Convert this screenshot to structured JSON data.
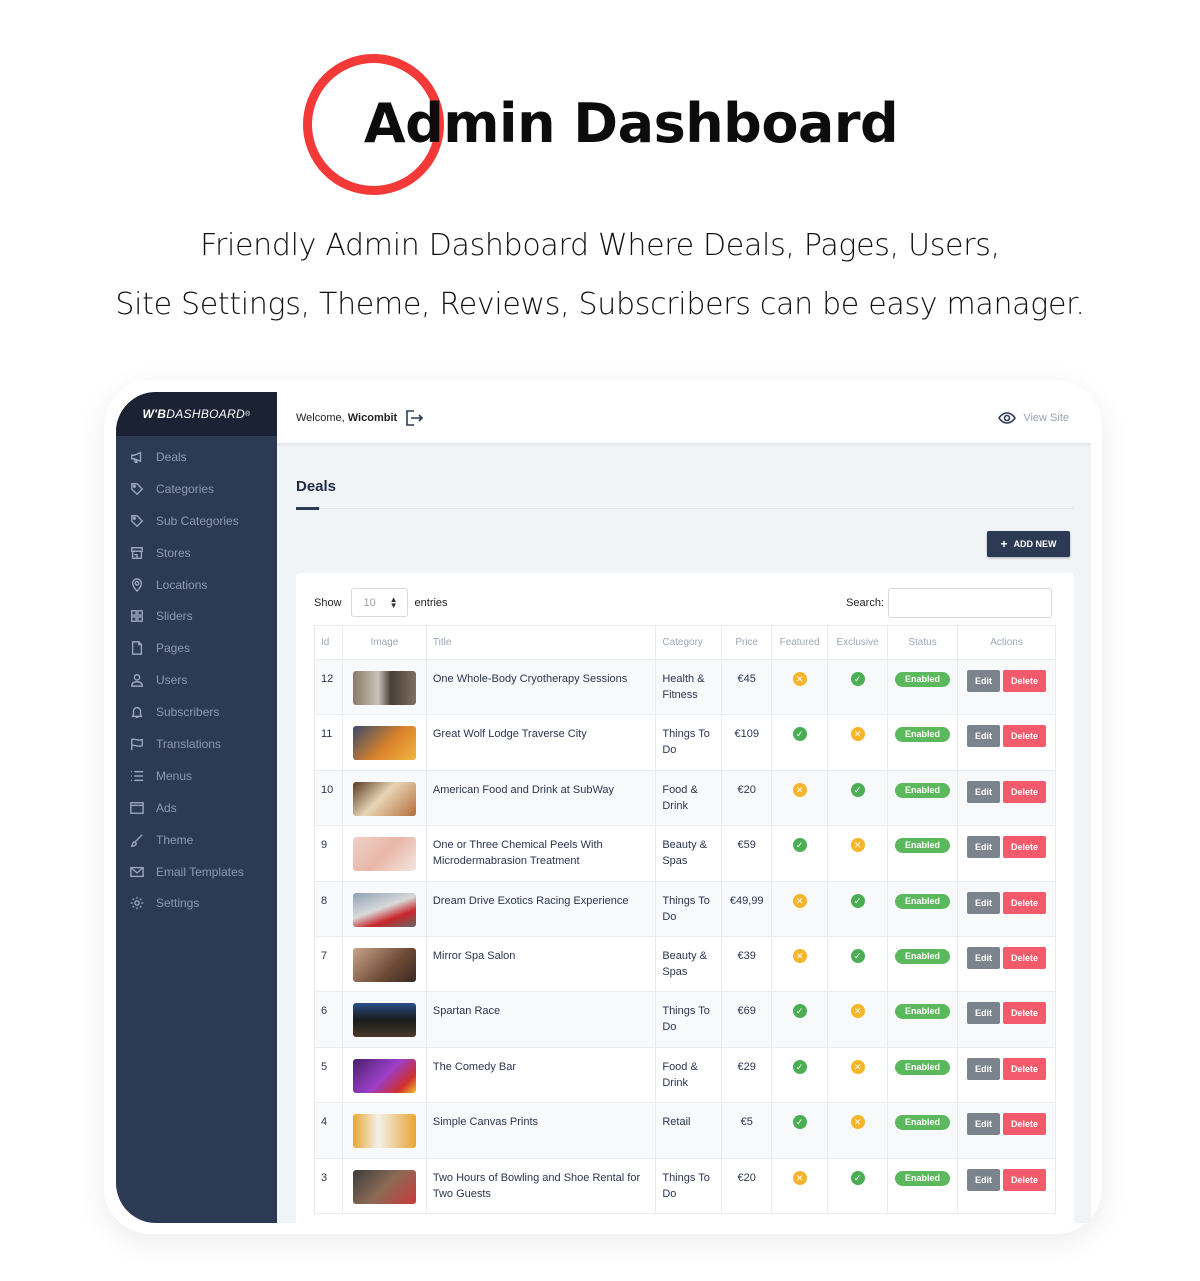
{
  "hero": {
    "title": "Admin Dashboard",
    "subtitle_line1": "Friendly Admin Dashboard Where Deals, Pages, Users,",
    "subtitle_line2": "Site Settings, Theme, Reviews, Subscribers can be easy manager.",
    "accent_color": "#f43939"
  },
  "brand": {
    "part1": "W'B",
    "part2": "DASHBOARD",
    "reg": "®"
  },
  "sidebar": {
    "items": [
      {
        "label": "Deals",
        "icon": "megaphone-icon"
      },
      {
        "label": "Categories",
        "icon": "tag-icon"
      },
      {
        "label": "Sub Categories",
        "icon": "tag-icon"
      },
      {
        "label": "Stores",
        "icon": "store-icon"
      },
      {
        "label": "Locations",
        "icon": "map-pin-icon"
      },
      {
        "label": "Sliders",
        "icon": "grid-icon"
      },
      {
        "label": "Pages",
        "icon": "file-icon"
      },
      {
        "label": "Users",
        "icon": "user-icon"
      },
      {
        "label": "Subscribers",
        "icon": "bell-icon"
      },
      {
        "label": "Translations",
        "icon": "flag-icon"
      },
      {
        "label": "Menus",
        "icon": "list-icon"
      },
      {
        "label": "Ads",
        "icon": "window-icon"
      },
      {
        "label": "Theme",
        "icon": "brush-icon"
      },
      {
        "label": "Email Templates",
        "icon": "mail-icon"
      },
      {
        "label": "Settings",
        "icon": "gear-icon"
      }
    ]
  },
  "topbar": {
    "welcome_prefix": "Welcome, ",
    "username": "Wicombit",
    "view_site": "View Site"
  },
  "page": {
    "title": "Deals",
    "add_new": "ADD NEW",
    "show_label": "Show",
    "entries_value": "10",
    "entries_label": "entries",
    "search_label": "Search:",
    "search_value": ""
  },
  "table": {
    "headers": [
      "Id",
      "Image",
      "Title",
      "Category",
      "Price",
      "Featured",
      "Exclusive",
      "Status",
      "Actions"
    ],
    "rows": [
      {
        "id": "12",
        "title": "One Whole-Body Cryotherapy Sessions",
        "category": "Health & Fitness",
        "price": "€45",
        "featured": false,
        "exclusive": true,
        "status": "Enabled"
      },
      {
        "id": "11",
        "title": "Great Wolf Lodge Traverse City",
        "category": "Things To Do",
        "price": "€109",
        "featured": true,
        "exclusive": false,
        "status": "Enabled"
      },
      {
        "id": "10",
        "title": "American Food and Drink at SubWay",
        "category": "Food & Drink",
        "price": "€20",
        "featured": false,
        "exclusive": true,
        "status": "Enabled"
      },
      {
        "id": "9",
        "title": "One or Three Chemical Peels With Microdermabrasion Treatment",
        "category": "Beauty & Spas",
        "price": "€59",
        "featured": true,
        "exclusive": false,
        "status": "Enabled"
      },
      {
        "id": "8",
        "title": "Dream Drive Exotics Racing Experience",
        "category": "Things To Do",
        "price": "€49,99",
        "featured": false,
        "exclusive": true,
        "status": "Enabled"
      },
      {
        "id": "7",
        "title": "Mirror Spa Salon",
        "category": "Beauty & Spas",
        "price": "€39",
        "featured": false,
        "exclusive": true,
        "status": "Enabled"
      },
      {
        "id": "6",
        "title": "Spartan Race",
        "category": "Things To Do",
        "price": "€69",
        "featured": true,
        "exclusive": false,
        "status": "Enabled"
      },
      {
        "id": "5",
        "title": "The Comedy Bar",
        "category": "Food & Drink",
        "price": "€29",
        "featured": true,
        "exclusive": false,
        "status": "Enabled"
      },
      {
        "id": "4",
        "title": "Simple Canvas Prints",
        "category": "Retail",
        "price": "€5",
        "featured": true,
        "exclusive": false,
        "status": "Enabled"
      },
      {
        "id": "3",
        "title": "Two Hours of Bowling and Shoe Rental for Two Guests",
        "category": "Things To Do",
        "price": "€20",
        "featured": false,
        "exclusive": true,
        "status": "Enabled"
      }
    ],
    "edit_label": "Edit",
    "delete_label": "Delete",
    "yes_glyph": "✓",
    "no_glyph": "✕"
  },
  "colors": {
    "sidebar_bg": "#2d3a54",
    "brand_bg": "#1b2233",
    "success": "#5cb85c",
    "warning": "#f6b52a",
    "danger": "#f35b6c",
    "secondary": "#7b838d"
  }
}
